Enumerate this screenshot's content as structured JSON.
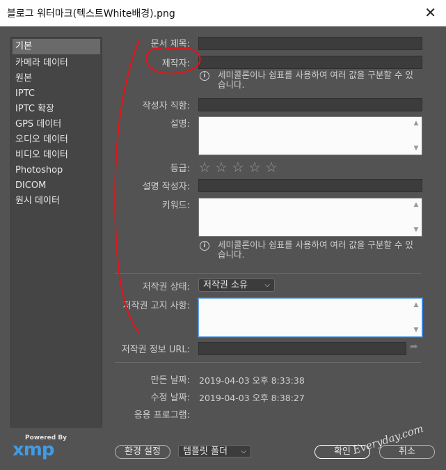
{
  "window": {
    "title": "블로그 워터마크(텍스트White배경).png",
    "close_glyph": "✕"
  },
  "sidebar": {
    "items": [
      {
        "label": "기본",
        "active": true
      },
      {
        "label": "카메라 데이터"
      },
      {
        "label": "원본"
      },
      {
        "label": "IPTC"
      },
      {
        "label": "IPTC 확장"
      },
      {
        "label": "GPS 데이터"
      },
      {
        "label": "오디오 데이터"
      },
      {
        "label": "비디오 데이터"
      },
      {
        "label": "Photoshop"
      },
      {
        "label": "DICOM"
      },
      {
        "label": "원시 데이터"
      }
    ]
  },
  "logo": {
    "powered_by": "Powered By",
    "brand": "xmp"
  },
  "form": {
    "doc_title_label": "문서 제목:",
    "author_label": "제작자:",
    "author_hint": "세미콜론이나 쉼표를 사용하여 여러 값을 구분할 수 있습니다.",
    "author_title_label": "작성자 직함:",
    "description_label": "설명:",
    "rating_label": "등급:",
    "rating_value": 0,
    "rating_max": 5,
    "desc_writer_label": "설명 작성자:",
    "keywords_label": "키워드:",
    "keywords_hint": "세미콜론이나 쉼표를 사용하여 여러 값을 구분할 수 있습니다.",
    "copyright_status_label": "저작권 상태:",
    "copyright_status_value": "저작권 소유",
    "copyright_notice_label": "저작권 고지 사항:",
    "copyright_url_label": "저작권 정보 URL:",
    "created_label": "만든 날짜:",
    "created_value": "2019-04-03 오후 8:33:38",
    "modified_label": "수정 날짜:",
    "modified_value": "2019-04-03 오후 8:38:27",
    "app_label": "응용 프로그램:",
    "app_value": ""
  },
  "footer": {
    "preferences": "환경 설정",
    "template_folder": "템플릿 폴더",
    "ok": "확인",
    "cancel": "취소",
    "watermark": "Everyday.com"
  },
  "colors": {
    "dialog_bg": "#535353",
    "field_bg": "#3c3c3c",
    "focus": "#2c78d2",
    "xmp_blue": "#3f9ce8",
    "annotation": "#e0151a"
  }
}
